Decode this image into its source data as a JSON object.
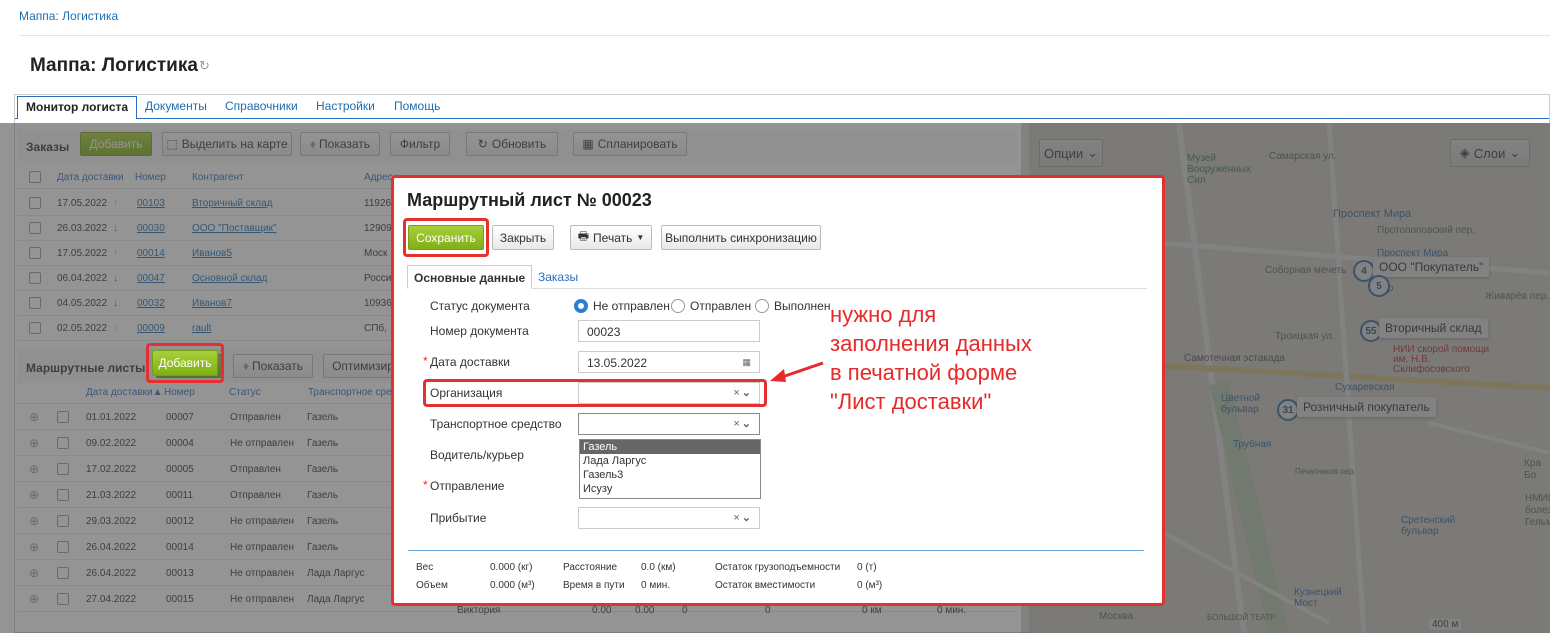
{
  "breadcrumb": "Маппа: Логистика",
  "page_title": "Маппа: Логистика",
  "tabs": [
    "Монитор логиста",
    "Документы",
    "Справочники",
    "Настройки",
    "Помощь"
  ],
  "orders": {
    "title": "Заказы",
    "buttons": {
      "add": "Добавить",
      "select_map": "Выделить на карте",
      "show": "Показать",
      "filter": "Фильтр",
      "refresh": "Обновить",
      "plan": "Спланировать"
    },
    "columns": [
      "Дата доставки",
      "Номер",
      "Контрагент",
      "Адрес"
    ],
    "rows": [
      {
        "date": "17.05.2022",
        "dir": "↑",
        "num": "00103",
        "contr": "Вторичный склад",
        "addr": "11926"
      },
      {
        "date": "26.03.2022",
        "dir": "↓",
        "num": "00030",
        "contr": "ООО \"Поставщик\"",
        "addr": "12909"
      },
      {
        "date": "17.05.2022",
        "dir": "↑",
        "num": "00014",
        "contr": "Иванов5",
        "addr": "Моск"
      },
      {
        "date": "06.04.2022",
        "dir": "↓",
        "num": "00047",
        "contr": "Основной склад",
        "addr": "Росси"
      },
      {
        "date": "04.05.2022",
        "dir": "↓",
        "num": "00032",
        "contr": "Иванов7",
        "addr": "10936"
      },
      {
        "date": "02.05.2022",
        "dir": "↑",
        "num": "00009",
        "contr": "rault",
        "addr": "СПб,"
      }
    ]
  },
  "routes": {
    "title": "Маршрутные листы",
    "buttons": {
      "add": "Добавить",
      "show": "Показать",
      "optimize": "Оптимизир"
    },
    "columns": [
      "Дата доставки▲",
      "Номер",
      "Статус",
      "Транспортное сре"
    ],
    "rows": [
      {
        "date": "01.01.2022",
        "num": "00007",
        "status": "Отправлен",
        "vehicle": "Газель"
      },
      {
        "date": "09.02.2022",
        "num": "00004",
        "status": "Не отправлен",
        "vehicle": "Газель"
      },
      {
        "date": "17.02.2022",
        "num": "00005",
        "status": "Отправлен",
        "vehicle": "Газель"
      },
      {
        "date": "21.03.2022",
        "num": "00011",
        "status": "Отправлен",
        "vehicle": "Газель"
      },
      {
        "date": "29.03.2022",
        "num": "00012",
        "status": "Не отправлен",
        "vehicle": "Газель"
      },
      {
        "date": "26.04.2022",
        "num": "00014",
        "status": "Не отправлен",
        "vehicle": "Газель"
      },
      {
        "date": "26.04.2022",
        "num": "00013",
        "status": "Не отправлен",
        "vehicle": "Лада Ларгус"
      },
      {
        "date": "27.04.2022",
        "num": "00015",
        "status": "Не отправлен",
        "vehicle": "Лада Ларгус"
      }
    ],
    "tail_texts": [
      "Виктория",
      "0.00",
      "0.00",
      "0",
      "0",
      "0 км",
      "0 мин."
    ]
  },
  "map": {
    "options": "Опции",
    "layers": "Слои",
    "labels": [
      "Музей Вооруженных Сил",
      "Самарская ул.",
      "Проспект Мира",
      "Протопоповский пер.",
      "Проспект Мира",
      "Соборная мечеть",
      "Антр",
      "Живарёв пер.",
      "Троицкая ул.",
      "Самотечная эстакада",
      "НИИ скорой помощи им. Н.В. Склифосовского",
      "Сухаревская",
      "Цветной бульвар",
      "Трубная",
      "Печатников пер.",
      "Сретенский бульвар",
      "Кузнецкий Мост",
      "Москва",
      "БОЛЬШОЙ ТЕАТР",
      "НМИЦ г",
      "болез",
      "Гельм",
      "Кра",
      "Бо"
    ],
    "pins": [
      {
        "n": "4",
        "label": "ООО \"Покупатель\""
      },
      {
        "n": "5",
        "label": ""
      },
      {
        "n": "55",
        "label": "Вторичный склад"
      },
      {
        "n": "31",
        "label": "Розничный покупатель"
      }
    ],
    "scale": "400 м"
  },
  "dialog": {
    "title": "Маршрутный лист № 00023",
    "buttons": {
      "save": "Сохранить",
      "close": "Закрыть",
      "print": "Печать",
      "sync": "Выполнить синхронизацию"
    },
    "tabs": [
      "Основные данные",
      "Заказы"
    ],
    "fields": {
      "status_label": "Статус документа",
      "status_options": [
        "Не отправлен",
        "Отправлен",
        "Выполнен"
      ],
      "number_label": "Номер документа",
      "number_value": "00023",
      "date_label": "Дата доставки",
      "date_value": "13.05.2022",
      "org_label": "Организация",
      "vehicle_label": "Транспортное средство",
      "driver_label": "Водитель/курьер",
      "departure_label": "Отправление",
      "arrival_label": "Прибытие"
    },
    "vehicle_options": [
      "Газель",
      "Лада Ларгус",
      "Газель3",
      "Исузу"
    ],
    "footer": {
      "weight_label": "Вес",
      "weight_value": "0.000 (кг)",
      "volume_label": "Объем",
      "volume_value": "0.000 (м³)",
      "distance_label": "Расстояние",
      "distance_value": "0.0 (км)",
      "time_label": "Время в пути",
      "time_value": "0 мин.",
      "cargo_label": "Остаток грузоподъемности",
      "cargo_value": "0 (т)",
      "capacity_label": "Остаток вместимости",
      "capacity_value": "0 (м³)"
    }
  },
  "annotation": [
    "нужно для",
    "заполнения данных",
    "в печатной форме",
    "\"Лист доставки\""
  ],
  "colors": {
    "accent": "#2a6ebb",
    "green": "#8cbd1f",
    "red": "#e63030"
  }
}
